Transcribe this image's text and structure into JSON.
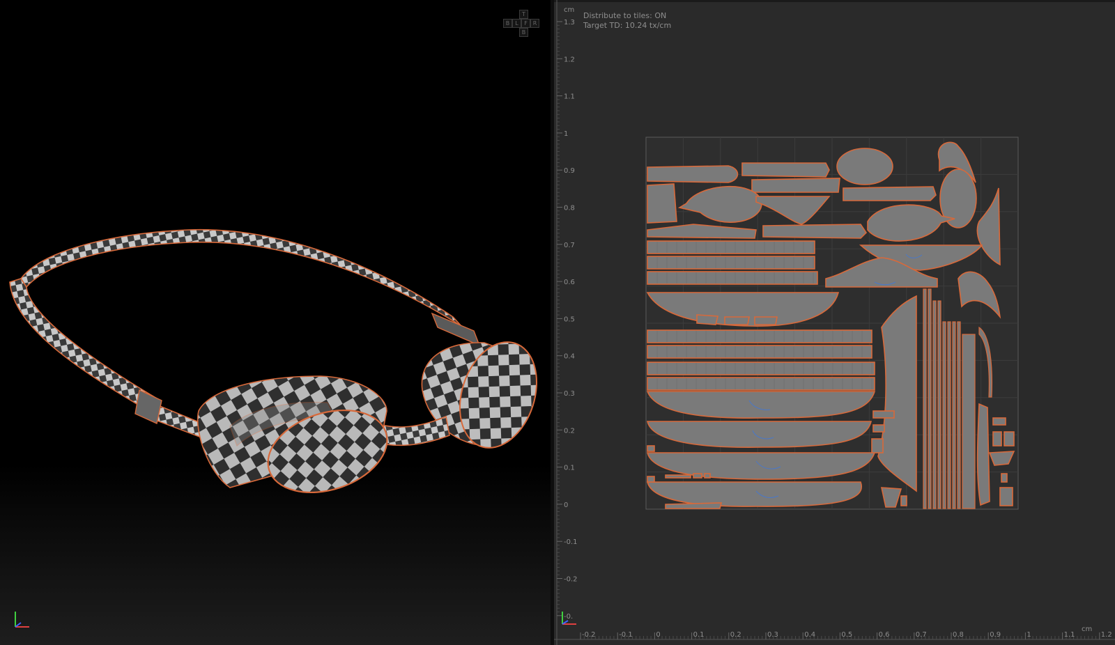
{
  "viewport3d": {
    "view_cube": {
      "top": "T",
      "back": "B",
      "left": "L",
      "front": "F",
      "right": "R",
      "bottom": "B"
    }
  },
  "uv_editor": {
    "info": {
      "distribute_tiles": "Distribute to tiles: ON",
      "target_td": "Target TD: 10.24 tx/cm"
    },
    "unit_left": "cm",
    "unit_bottom": "cm",
    "v_ticks": [
      "1.3",
      "1.2",
      "1.1",
      "1",
      "0.9",
      "0.8",
      "0.7",
      "0.6",
      "0.5",
      "0.4",
      "0.3",
      "0.2",
      "0.1",
      "0",
      "-0.1",
      "-0.2",
      "-0."
    ],
    "u_ticks": [
      "-0.2",
      "-0.1",
      "0",
      "0.1",
      "0.2",
      "0.3",
      "0.4",
      "0.5",
      "0.6",
      "0.7",
      "0.8",
      "0.9",
      "1",
      "1.1",
      "1.2"
    ]
  },
  "colors": {
    "seam": "#d8693a",
    "shell": "#7a7a7a",
    "panel_bg": "#2a2a2a",
    "axis_x": "#e04040",
    "axis_y": "#40d040",
    "axis_z": "#4060ff"
  },
  "icons": {
    "axis_gizmo_3d": "axis-gizmo-icon",
    "axis_gizmo_uv": "axis-gizmo-icon"
  }
}
